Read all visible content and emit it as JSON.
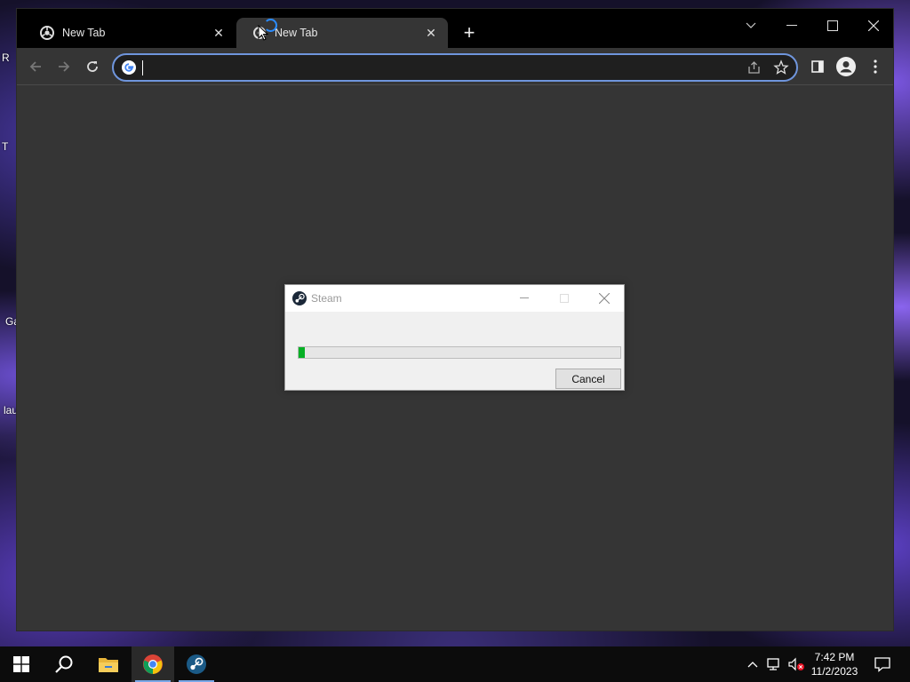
{
  "desktop": {
    "fragments": [
      "R",
      "T",
      "Ga",
      "lau"
    ]
  },
  "browser": {
    "tabs": [
      {
        "title": "New Tab",
        "active": false
      },
      {
        "title": "New Tab",
        "active": true
      }
    ],
    "omnibox": {
      "value": "",
      "placeholder": ""
    },
    "accent": "#6f95dc"
  },
  "steam_dialog": {
    "title": "Steam",
    "progress_fraction": 0.02,
    "cancel_label": "Cancel",
    "progress_color": "#06b025"
  },
  "taskbar": {
    "apps": [
      "start-icon",
      "search-icon",
      "file-explorer-icon",
      "chrome-icon",
      "steam-icon"
    ],
    "time": "7:42 PM",
    "date": "11/2/2023"
  }
}
